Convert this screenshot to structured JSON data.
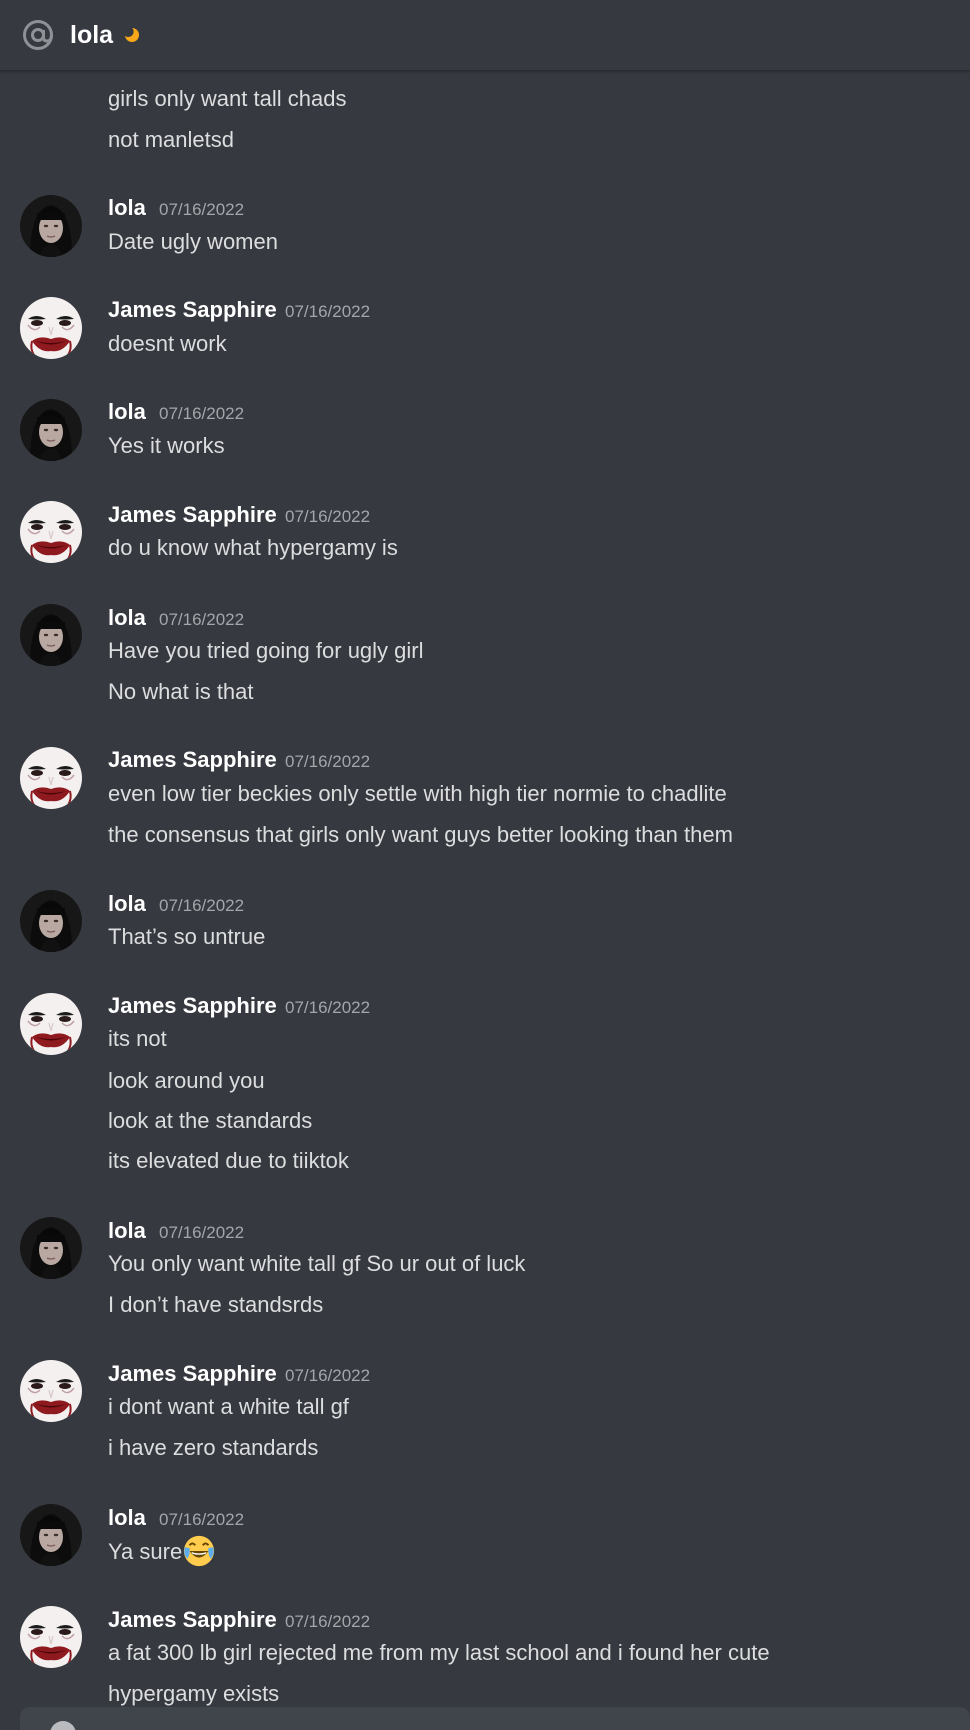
{
  "header": {
    "title": "lola",
    "channel_icon": "at-icon",
    "status_icon": "moon-icon",
    "status_color": "#faa81a"
  },
  "messages": {
    "m0": {
      "lines": [
        "girls only want tall chads",
        "not manletsd"
      ]
    },
    "m1": {
      "author": "lola",
      "timestamp": "07/16/2022",
      "lines": [
        "Date ugly women"
      ]
    },
    "m2": {
      "author": "James Sapphire",
      "timestamp": "07/16/2022",
      "lines": [
        "doesnt work"
      ]
    },
    "m3": {
      "author": "lola",
      "timestamp": "07/16/2022",
      "lines": [
        "Yes it works"
      ]
    },
    "m4": {
      "author": "James Sapphire",
      "timestamp": "07/16/2022",
      "lines": [
        "do u know what hypergamy is"
      ]
    },
    "m5": {
      "author": "lola",
      "timestamp": "07/16/2022",
      "lines": [
        "Have you tried going for ugly girl",
        "No what is that"
      ]
    },
    "m6": {
      "author": "James Sapphire",
      "timestamp": "07/16/2022",
      "lines": [
        "even low tier beckies only settle with high tier normie to chadlite",
        "the consensus that girls only want guys better looking than them"
      ]
    },
    "m7": {
      "author": "lola",
      "timestamp": "07/16/2022",
      "lines": [
        "That’s so untrue"
      ]
    },
    "m8": {
      "author": "James Sapphire",
      "timestamp": "07/16/2022",
      "lines": [
        "its not",
        "look around you",
        "look at the standards",
        "its elevated due to tiiktok"
      ]
    },
    "m9": {
      "author": "lola",
      "timestamp": "07/16/2022",
      "lines": [
        "You only want white tall gf So ur out of luck",
        "I don’t have standsrds"
      ]
    },
    "m10": {
      "author": "James Sapphire",
      "timestamp": "07/16/2022",
      "lines": [
        "i dont want a white tall gf",
        "i have zero standards"
      ]
    },
    "m11": {
      "author": "lola",
      "timestamp": "07/16/2022",
      "lines": [
        "Ya sure"
      ],
      "emoji": "joy-emoji"
    },
    "m12": {
      "author": "James Sapphire",
      "timestamp": "07/16/2022",
      "lines": [
        "a fat 300 lb girl rejected me from my last school and i found her cute",
        "hypergamy exists"
      ]
    }
  },
  "colors": {
    "background": "#36393f",
    "username": "#ffffff",
    "message_text": "#dcddde",
    "timestamp": "#a3a6aa"
  }
}
